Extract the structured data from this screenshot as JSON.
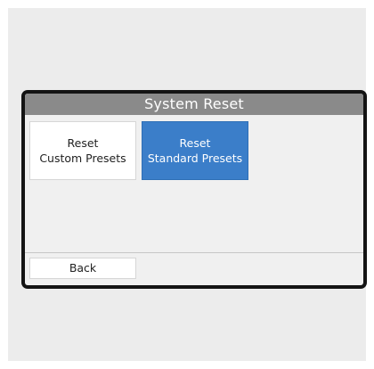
{
  "screen": {
    "title": "System Reset"
  },
  "options": [
    {
      "line1": "Reset",
      "line2": "Custom Presets",
      "selected": false
    },
    {
      "line1": "Reset",
      "line2": "Standard Presets",
      "selected": true
    }
  ],
  "footer": {
    "back_label": "Back"
  },
  "colors": {
    "titlebar": "#8a8a8a",
    "selected_tile": "#3b7ec9",
    "bezel": "#141414",
    "screen_bg": "#f0f0f0"
  }
}
